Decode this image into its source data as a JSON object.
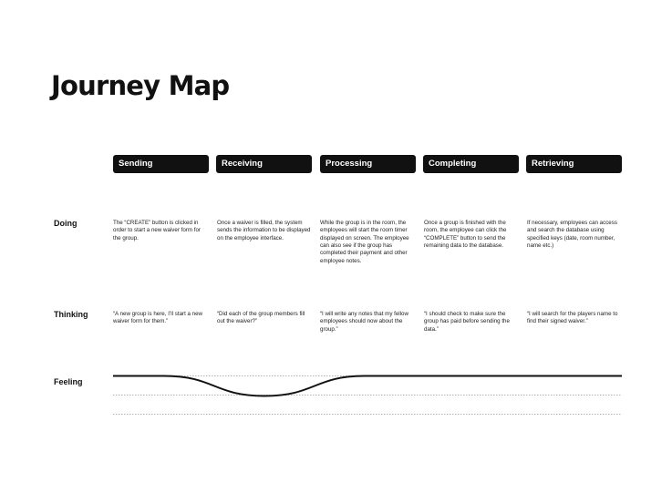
{
  "title": "Journey Map",
  "stages": [
    {
      "label": "Sending"
    },
    {
      "label": "Receiving"
    },
    {
      "label": "Processing"
    },
    {
      "label": "Completing"
    },
    {
      "label": "Retrieving"
    }
  ],
  "rows": {
    "doing": {
      "label": "Doing",
      "cells": [
        "The “CREATE” button is clicked in order to start a new waiver form for the group.",
        "Once a waiver is filled, the system sends the information to be displayed on the employee interface.",
        "While the group is in the room, the employees will start the room timer displayed on screen. The employee can also see if the group has completed their payment and other employee notes.",
        "Once a group is finished with the room, the employee can click the “COMPLETE” button to send the remaining data to the database.",
        "If necessary, employees can access and search the database using specified keys (date, room number, name etc.)"
      ]
    },
    "thinking": {
      "label": "Thinking",
      "cells": [
        "“A new group is here, I’ll start a new waiver form for them.”",
        "“Did each of the group members fill out the waiver?”",
        "“I will write any notes that my fellow employees should now about the group.”",
        "“I should check to make sure the group has paid before sending the data.”",
        "“I will search for the players name to find their signed waiver.”"
      ]
    },
    "feeling": {
      "label": "Feeling"
    }
  },
  "feeling_levels": [
    1,
    1,
    0,
    1,
    1,
    1,
    1
  ],
  "colors": {
    "ink": "#111111",
    "stage_text": "#ffffff",
    "guide": "#9a9a9a"
  }
}
